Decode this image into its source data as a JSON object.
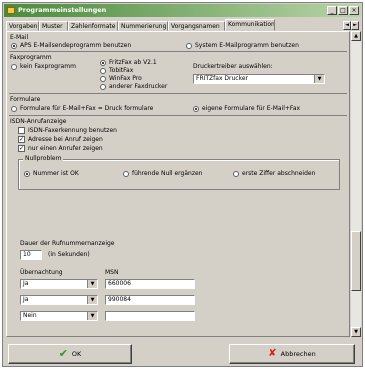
{
  "window": {
    "title": "Programmeinstellungen",
    "buttons": [
      "_",
      "□",
      "×"
    ]
  },
  "tabs": [
    "Vorgaben",
    "Muster",
    "Zahlenformate",
    "Nummerierung",
    "Vorgangsnamen",
    "Kommunikation"
  ],
  "tab_scroll": [
    "◄",
    "►"
  ],
  "active_tab_index": 5,
  "email": {
    "label": "E-Mail",
    "opt_aps": "APS E-Mailsendeprogramm benutzen",
    "opt_system": "System E-Mailprogramm benutzen"
  },
  "fax": {
    "label": "Faxprogramm",
    "opt_none": "kein Faxprogramm",
    "opt_fritz": "FritzFax ab V2.1",
    "opt_tobit": "TobitFax",
    "opt_winfax": "WinFax Pro",
    "opt_other": "anderer Faxdrucker",
    "driver_label": "Druckertreiber auswählen:",
    "driver_value": "FRITZfax Drucker"
  },
  "faxform": {
    "label": "Formulare",
    "opt_print": "Formulare für E-Mail+Fax = Druck formulare",
    "opt_own": "eigene Formulare für E-Mail+Fax"
  },
  "isdn": {
    "label": "ISDN-Anrufanzeige",
    "use": "ISDN-Faxerkennung benutzen",
    "show_caller": "Adresse bei Anruf zeigen",
    "only_one": "nur einen Anrufer zeigen",
    "use_checked": false,
    "show_checked": true,
    "only_checked": true
  },
  "numproblem": {
    "label": "Nullproblem",
    "opt_number": "Nummer ist OK",
    "opt_zero": "führende Null ergänzen",
    "opt_cut": "erste Ziffer abschneiden"
  },
  "duration": {
    "label": "Dauer der Rufnummernanzeige",
    "value": "10",
    "unit": "(in Sekunden)"
  },
  "msn": {
    "col1": "Übernachtung",
    "col2": "MSN",
    "rows": [
      {
        "sel": "Ja",
        "msn": "660006"
      },
      {
        "sel": "Ja",
        "msn": "990084"
      },
      {
        "sel": "Nein",
        "msn": ""
      }
    ]
  },
  "buttons": {
    "ok": "OK",
    "cancel": "Abbrechen"
  },
  "icons": {
    "ok": "✔",
    "cancel": "✘"
  }
}
